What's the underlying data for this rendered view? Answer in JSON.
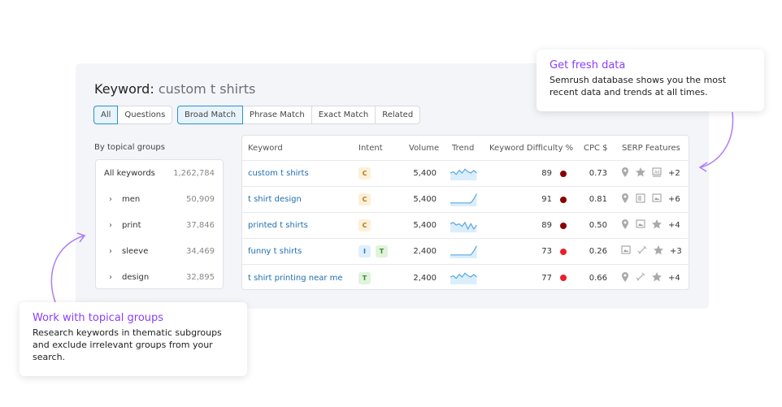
{
  "header": {
    "label": "Keyword:",
    "query": "custom t shirts"
  },
  "filters1": [
    {
      "label": "All",
      "active": true
    },
    {
      "label": "Questions",
      "active": false
    }
  ],
  "filters2": [
    {
      "label": "Broad Match",
      "active": true
    },
    {
      "label": "Phrase Match",
      "active": false
    },
    {
      "label": "Exact Match",
      "active": false
    },
    {
      "label": "Related",
      "active": false
    }
  ],
  "groups": {
    "title": "By topical groups",
    "items": [
      {
        "label": "All keywords",
        "count": "1,262,784"
      },
      {
        "label": "men",
        "count": "50,909"
      },
      {
        "label": "print",
        "count": "37,846"
      },
      {
        "label": "sleeve",
        "count": "34,469"
      },
      {
        "label": "design",
        "count": "32,895"
      }
    ]
  },
  "table": {
    "columns": [
      "Keyword",
      "Intent",
      "Volume",
      "Trend",
      "Keyword Difficulty %",
      "CPC $",
      "SERP Features"
    ],
    "rows": [
      {
        "keyword": "custom t shirts",
        "intent": [
          "C"
        ],
        "volume": "5,400",
        "trend": [
          5,
          6,
          4,
          7,
          5,
          8,
          6,
          5,
          7,
          5
        ],
        "kd": "89",
        "kd_color": "#8b0000",
        "cpc": "0.73",
        "serp": [
          "pin-icon",
          "star-icon",
          "ad-icon"
        ],
        "more": "+2"
      },
      {
        "keyword": "t shirt design",
        "intent": [
          "C"
        ],
        "volume": "5,400",
        "trend": [
          2,
          2,
          2,
          2,
          2,
          2,
          2,
          2,
          5,
          9
        ],
        "kd": "91",
        "kd_color": "#8b0000",
        "cpc": "0.81",
        "serp": [
          "pin-icon",
          "doc-icon",
          "image-icon"
        ],
        "more": "+6"
      },
      {
        "keyword": "printed t shirts",
        "intent": [
          "C"
        ],
        "volume": "5,400",
        "trend": [
          6,
          7,
          5,
          6,
          4,
          7,
          2,
          6,
          2,
          5
        ],
        "kd": "89",
        "kd_color": "#8b0000",
        "cpc": "0.50",
        "serp": [
          "pin-icon",
          "image-icon",
          "star-icon"
        ],
        "more": "+4"
      },
      {
        "keyword": "funny t shirts",
        "intent": [
          "I",
          "T"
        ],
        "volume": "2,400",
        "trend": [
          2,
          2,
          2,
          2,
          2,
          2,
          2,
          2,
          5,
          9
        ],
        "kd": "73",
        "kd_color": "#e8202a",
        "cpc": "0.26",
        "serp": [
          "image-icon",
          "link-icon",
          "star-icon"
        ],
        "more": "+3"
      },
      {
        "keyword": "t shirt printing near me",
        "intent": [
          "T"
        ],
        "volume": "2,400",
        "trend": [
          5,
          6,
          4,
          7,
          5,
          8,
          6,
          5,
          7,
          5
        ],
        "kd": "77",
        "kd_color": "#e8202a",
        "cpc": "0.66",
        "serp": [
          "pin-icon",
          "link-icon",
          "star-icon"
        ],
        "more": "+4"
      }
    ]
  },
  "callouts": {
    "fresh": {
      "title": "Get fresh data",
      "text": "Semrush database shows you the most recent data and trends at all times."
    },
    "groups": {
      "title": "Work with topical groups",
      "text": "Research keywords in thematic subgroups and exclude irrelevant groups from your search."
    }
  },
  "colors": {
    "accent": "#8a3ffc",
    "link": "#1f6fb0",
    "panel": "#f4f5f9"
  }
}
